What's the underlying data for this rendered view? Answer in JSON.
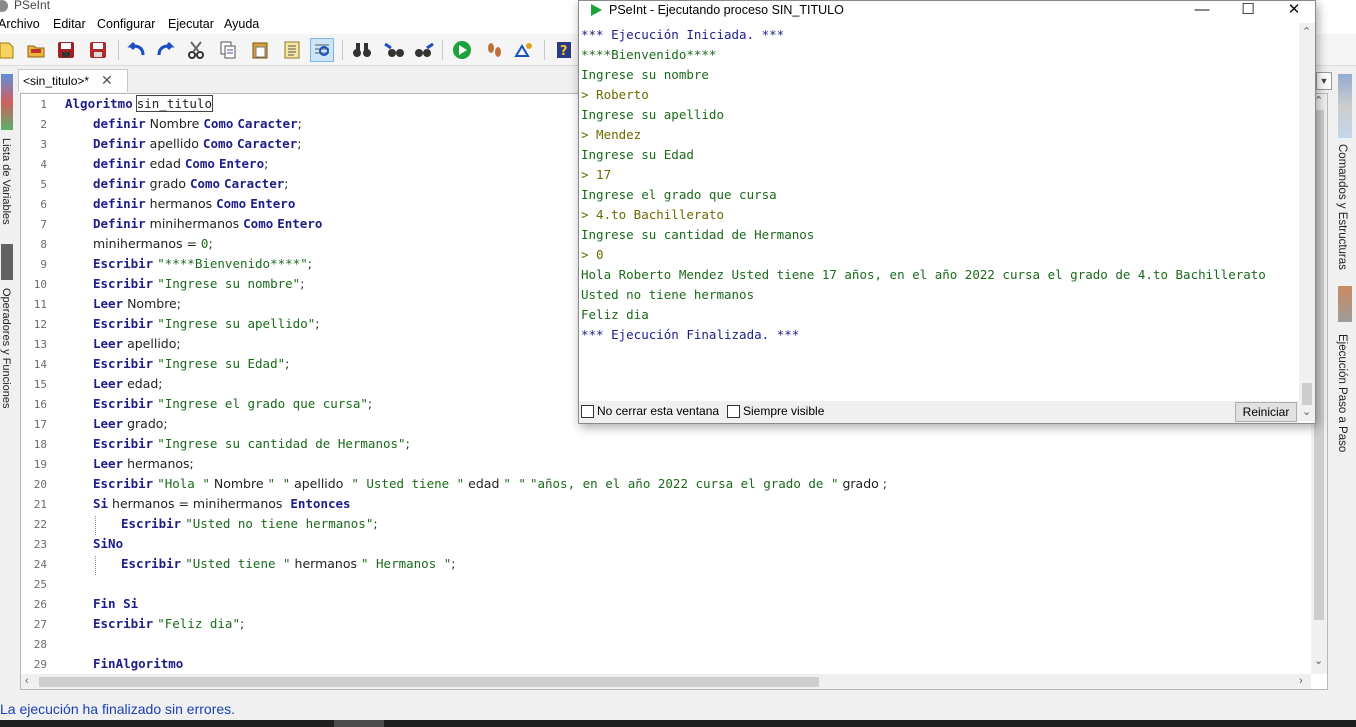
{
  "window": {
    "app_title": "PSeInt"
  },
  "menu": [
    "Archivo",
    "Editar",
    "Configurar",
    "Ejecutar",
    "Ayuda"
  ],
  "toolbar": {
    "icons": [
      "new-icon",
      "open-icon",
      "save-icon",
      "save-as-icon",
      "undo-icon",
      "redo-icon",
      "cut-icon",
      "copy-icon",
      "paste-icon",
      "clipboard-icon",
      "indent-icon",
      "find-icon",
      "binoculars-icon",
      "find-prev-icon",
      "find-next-icon",
      "run-icon",
      "step-icon",
      "debug-icon",
      "help-icon"
    ]
  },
  "tab": {
    "label": "<sin_titulo>*",
    "close": "✕"
  },
  "left_panel": {
    "variables_label": "Lista de Variables",
    "operators_label": "Operadores y Funciones"
  },
  "right_panel": {
    "commands_label": "Comandos y Estructuras",
    "step_label": "Ejecución Paso a Paso"
  },
  "editor": {
    "lines": [
      {
        "n": "1",
        "indent": 0,
        "parts": [
          [
            "kw",
            "Algoritmo"
          ],
          [
            "txt",
            " "
          ],
          [
            "boxed",
            "sin_titulo"
          ]
        ]
      },
      {
        "n": "2",
        "indent": 1,
        "parts": [
          [
            "kw",
            "definir"
          ],
          [
            "txt",
            " Nombre "
          ],
          [
            "kw",
            "Como"
          ],
          [
            "txt",
            " "
          ],
          [
            "kw",
            "Caracter"
          ],
          [
            "txt",
            ";"
          ]
        ]
      },
      {
        "n": "3",
        "indent": 1,
        "parts": [
          [
            "kw",
            "Definir"
          ],
          [
            "txt",
            " apellido "
          ],
          [
            "kw",
            "Como"
          ],
          [
            "txt",
            " "
          ],
          [
            "kw",
            "Caracter"
          ],
          [
            "txt",
            ";"
          ]
        ]
      },
      {
        "n": "4",
        "indent": 1,
        "parts": [
          [
            "kw",
            "definir"
          ],
          [
            "txt",
            " edad "
          ],
          [
            "kw",
            "Como"
          ],
          [
            "txt",
            " "
          ],
          [
            "kw",
            "Entero"
          ],
          [
            "txt",
            ";"
          ]
        ]
      },
      {
        "n": "5",
        "indent": 1,
        "parts": [
          [
            "kw",
            "definir"
          ],
          [
            "txt",
            " grado "
          ],
          [
            "kw",
            "Como"
          ],
          [
            "txt",
            " "
          ],
          [
            "kw",
            "Caracter"
          ],
          [
            "txt",
            ";"
          ]
        ]
      },
      {
        "n": "6",
        "indent": 1,
        "parts": [
          [
            "kw",
            "definir"
          ],
          [
            "txt",
            " hermanos "
          ],
          [
            "kw",
            "Como"
          ],
          [
            "txt",
            " "
          ],
          [
            "kw",
            "Entero"
          ]
        ]
      },
      {
        "n": "7",
        "indent": 1,
        "parts": [
          [
            "kw",
            "Definir"
          ],
          [
            "txt",
            " minihermanos "
          ],
          [
            "kw",
            "Como"
          ],
          [
            "txt",
            " "
          ],
          [
            "kw",
            "Entero"
          ]
        ]
      },
      {
        "n": "8",
        "indent": 1,
        "parts": [
          [
            "txt",
            "minihermanos = "
          ],
          [
            "num",
            "0"
          ],
          [
            "txt",
            ";"
          ]
        ]
      },
      {
        "n": "9",
        "indent": 1,
        "parts": [
          [
            "kw",
            "Escribir"
          ],
          [
            "txt",
            " "
          ],
          [
            "str",
            "\"****Bienvenido****\""
          ],
          [
            "txt",
            ";"
          ]
        ]
      },
      {
        "n": "10",
        "indent": 1,
        "parts": [
          [
            "kw",
            "Escribir"
          ],
          [
            "txt",
            " "
          ],
          [
            "str",
            "\"Ingrese su nombre\""
          ],
          [
            "txt",
            ";"
          ]
        ]
      },
      {
        "n": "11",
        "indent": 1,
        "parts": [
          [
            "kw",
            "Leer"
          ],
          [
            "txt",
            " Nombre;"
          ]
        ]
      },
      {
        "n": "12",
        "indent": 1,
        "parts": [
          [
            "kw",
            "Escribir"
          ],
          [
            "txt",
            " "
          ],
          [
            "str",
            "\"Ingrese su apellido\""
          ],
          [
            "txt",
            ";"
          ]
        ]
      },
      {
        "n": "13",
        "indent": 1,
        "parts": [
          [
            "kw",
            "Leer"
          ],
          [
            "txt",
            " apellido;"
          ]
        ]
      },
      {
        "n": "14",
        "indent": 1,
        "parts": [
          [
            "kw",
            "Escribir"
          ],
          [
            "txt",
            " "
          ],
          [
            "str",
            "\"Ingrese su Edad\""
          ],
          [
            "txt",
            ";"
          ]
        ]
      },
      {
        "n": "15",
        "indent": 1,
        "parts": [
          [
            "kw",
            "Leer"
          ],
          [
            "txt",
            " edad;"
          ]
        ]
      },
      {
        "n": "16",
        "indent": 1,
        "parts": [
          [
            "kw",
            "Escribir"
          ],
          [
            "txt",
            " "
          ],
          [
            "str",
            "\"Ingrese el grado que cursa\""
          ],
          [
            "txt",
            ";"
          ]
        ]
      },
      {
        "n": "17",
        "indent": 1,
        "parts": [
          [
            "kw",
            "Leer"
          ],
          [
            "txt",
            " grado;"
          ]
        ]
      },
      {
        "n": "18",
        "indent": 1,
        "parts": [
          [
            "kw",
            "Escribir"
          ],
          [
            "txt",
            " "
          ],
          [
            "str",
            "\"Ingrese su cantidad de Hermanos\""
          ],
          [
            "txt",
            ";"
          ]
        ]
      },
      {
        "n": "19",
        "indent": 1,
        "parts": [
          [
            "kw",
            "Leer"
          ],
          [
            "txt",
            " hermanos;"
          ]
        ]
      },
      {
        "n": "20",
        "indent": 1,
        "parts": [
          [
            "kw",
            "Escribir"
          ],
          [
            "txt",
            " "
          ],
          [
            "str",
            "\"Hola \""
          ],
          [
            "txt",
            " Nombre "
          ],
          [
            "str",
            "\" \""
          ],
          [
            "txt",
            " apellido  "
          ],
          [
            "str",
            "\" Usted tiene \""
          ],
          [
            "txt",
            " edad "
          ],
          [
            "str",
            "\" \""
          ],
          [
            "txt",
            " "
          ],
          [
            "str",
            "\"años, en el año 2022 cursa el grado de \""
          ],
          [
            "txt",
            " grado ;"
          ]
        ]
      },
      {
        "n": "21",
        "indent": 1,
        "parts": [
          [
            "kw",
            "Si"
          ],
          [
            "txt",
            " hermanos = minihermanos  "
          ],
          [
            "kw",
            "Entonces"
          ]
        ]
      },
      {
        "n": "22",
        "indent": 2,
        "parts": [
          [
            "kw",
            "Escribir"
          ],
          [
            "txt",
            " "
          ],
          [
            "str",
            "\"Usted no tiene hermanos\""
          ],
          [
            "txt",
            ";"
          ]
        ]
      },
      {
        "n": "23",
        "indent": 1,
        "parts": [
          [
            "kw",
            "SiNo"
          ]
        ]
      },
      {
        "n": "24",
        "indent": 2,
        "parts": [
          [
            "kw",
            "Escribir"
          ],
          [
            "txt",
            " "
          ],
          [
            "str",
            "\"Usted tiene \""
          ],
          [
            "txt",
            " hermanos "
          ],
          [
            "str",
            "\" Hermanos \""
          ],
          [
            "txt",
            ";"
          ]
        ]
      },
      {
        "n": "25",
        "indent": 1,
        "parts": []
      },
      {
        "n": "26",
        "indent": 1,
        "parts": [
          [
            "kw",
            "Fin Si"
          ]
        ]
      },
      {
        "n": "27",
        "indent": 1,
        "parts": [
          [
            "kw",
            "Escribir"
          ],
          [
            "txt",
            " "
          ],
          [
            "str",
            "\"Feliz dia\""
          ],
          [
            "txt",
            ";"
          ]
        ]
      },
      {
        "n": "28",
        "indent": 1,
        "parts": []
      },
      {
        "n": "29",
        "indent": 1,
        "parts": [
          [
            "kw",
            "FinAlgoritmo"
          ]
        ]
      }
    ]
  },
  "status": {
    "text": "La ejecución ha finalizado sin errores."
  },
  "exec_window": {
    "title": "PSeInt - Ejecutando proceso SIN_TITULO",
    "minimize": "—",
    "maximize": "☐",
    "close": "✕",
    "console": [
      {
        "kind": "sys",
        "text": "*** Ejecución Iniciada. ***"
      },
      {
        "kind": "out",
        "text": "****Bienvenido****"
      },
      {
        "kind": "out",
        "text": "Ingrese su nombre"
      },
      {
        "kind": "in",
        "text": "> Roberto"
      },
      {
        "kind": "out",
        "text": "Ingrese su apellido"
      },
      {
        "kind": "in",
        "text": "> Mendez"
      },
      {
        "kind": "out",
        "text": "Ingrese su Edad"
      },
      {
        "kind": "in",
        "text": "> 17"
      },
      {
        "kind": "out",
        "text": "Ingrese el grado que cursa"
      },
      {
        "kind": "in",
        "text": "> 4.to Bachillerato"
      },
      {
        "kind": "out",
        "text": "Ingrese su cantidad de Hermanos"
      },
      {
        "kind": "in",
        "text": "> 0"
      },
      {
        "kind": "out",
        "text": "Hola Roberto Mendez Usted tiene 17 años, en el año 2022 cursa el grado de 4.to Bachillerato"
      },
      {
        "kind": "out",
        "text": "Usted no tiene hermanos"
      },
      {
        "kind": "out",
        "text": "Feliz dia"
      },
      {
        "kind": "sys",
        "text": "*** Ejecución Finalizada. ***"
      }
    ],
    "no_close_label": "No cerrar esta ventana",
    "always_visible_label": "Siempre visible",
    "restart_label": "Reiniciar"
  }
}
